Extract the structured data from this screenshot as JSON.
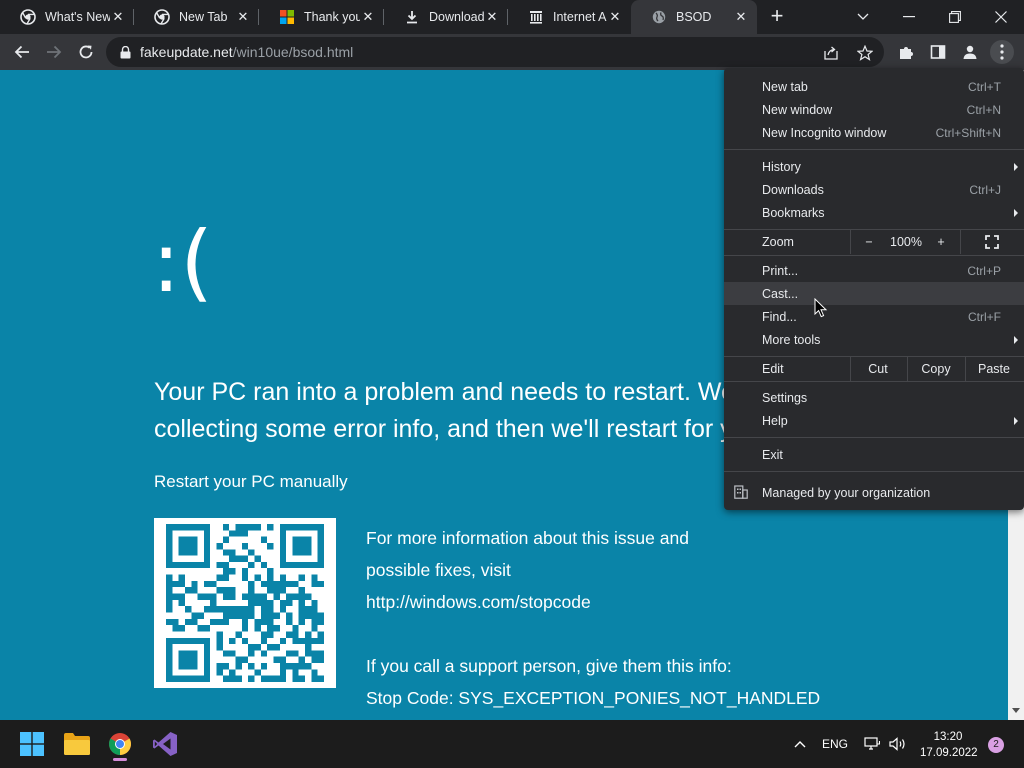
{
  "browser": {
    "tabs": [
      {
        "title": "What's New",
        "icon": "chrome-icon"
      },
      {
        "title": "New Tab",
        "icon": "chrome-icon"
      },
      {
        "title": "Thank you",
        "icon": "microsoft-icon"
      },
      {
        "title": "Downloads",
        "icon": "download-icon"
      },
      {
        "title": "Internet Ar",
        "icon": "archive-icon"
      },
      {
        "title": "BSOD",
        "icon": "globe-icon",
        "active": true
      }
    ],
    "url_host": "fakeupdate.net",
    "url_path": "/win10ue/bsod.html"
  },
  "page": {
    "frown": ":(",
    "message_line1": "Your PC ran into a problem and needs to restart. We're just",
    "message_line2": "collecting some error info, and then we'll restart for you.",
    "restart": "Restart your PC manually",
    "info_line1": "For more information about this issue and",
    "info_line2": "possible fixes, visit",
    "info_line3": "http://windows.com/stopcode",
    "support_line": "If you call a support person, give them this info:",
    "stop_code": "Stop Code: SYS_EXCEPTION_PONIES_NOT_HANDLED",
    "background_color": "#0a84a8"
  },
  "menu": {
    "new_tab": {
      "label": "New tab",
      "shortcut": "Ctrl+T"
    },
    "new_window": {
      "label": "New window",
      "shortcut": "Ctrl+N"
    },
    "incognito": {
      "label": "New Incognito window",
      "shortcut": "Ctrl+Shift+N"
    },
    "history": {
      "label": "History"
    },
    "downloads": {
      "label": "Downloads",
      "shortcut": "Ctrl+J"
    },
    "bookmarks": {
      "label": "Bookmarks"
    },
    "zoom": {
      "label": "Zoom",
      "minus": "−",
      "value": "100%",
      "plus": "+"
    },
    "print": {
      "label": "Print...",
      "shortcut": "Ctrl+P"
    },
    "cast": {
      "label": "Cast..."
    },
    "find": {
      "label": "Find...",
      "shortcut": "Ctrl+F"
    },
    "more_tools": {
      "label": "More tools"
    },
    "edit": {
      "label": "Edit",
      "cut": "Cut",
      "copy": "Copy",
      "paste": "Paste"
    },
    "settings": {
      "label": "Settings"
    },
    "help": {
      "label": "Help"
    },
    "exit": {
      "label": "Exit"
    },
    "managed": {
      "label": "Managed by your organization"
    }
  },
  "taskbar": {
    "language": "ENG",
    "time": "13:20",
    "date": "17.09.2022",
    "notifications": "2"
  }
}
